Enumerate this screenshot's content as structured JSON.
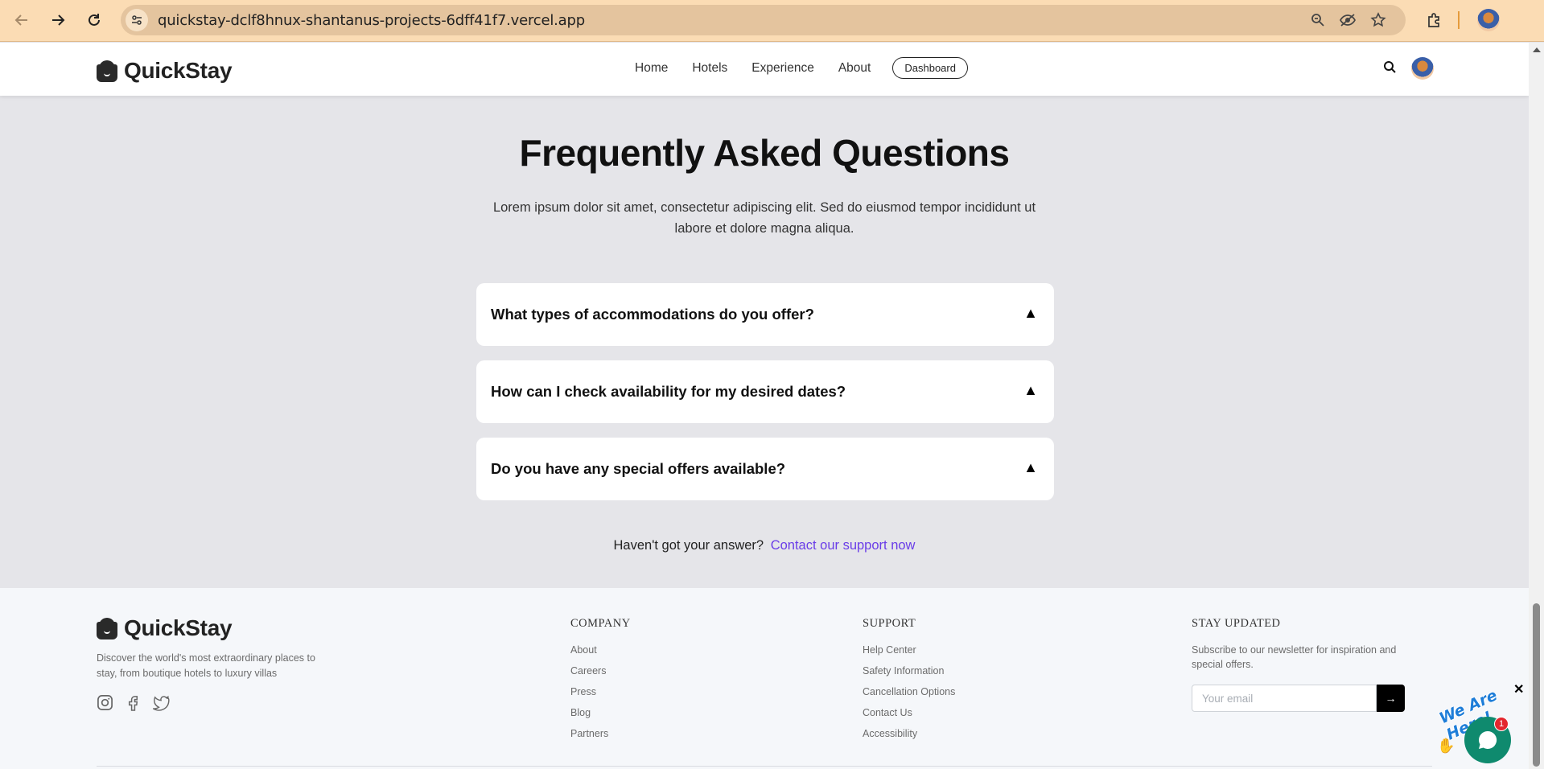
{
  "browser": {
    "url": "quickstay-dclf8hnux-shantanus-projects-6dff41f7.vercel.app"
  },
  "header": {
    "brand": "QuickStay",
    "nav": [
      "Home",
      "Hotels",
      "Experience",
      "About"
    ],
    "dashboard_label": "Dashboard"
  },
  "faq": {
    "title": "Frequently Asked Questions",
    "subtitle": "Lorem ipsum dolor sit amet, consectetur adipiscing elit. Sed do eiusmod tempor incididunt ut labore et dolore magna aliqua.",
    "items": [
      {
        "question": "What types of accommodations do you offer?",
        "toggle": "▲"
      },
      {
        "question": "How can I check availability for my desired dates?",
        "toggle": "▲"
      },
      {
        "question": "Do you have any special offers available?",
        "toggle": "▲"
      }
    ],
    "footer_text": "Haven't got your answer?",
    "footer_link": "Contact our support now"
  },
  "footer": {
    "brand": "QuickStay",
    "description": "Discover the world's most extraordinary places to stay, from boutique hotels to luxury villas",
    "socials": [
      "instagram-icon",
      "facebook-icon",
      "twitter-icon"
    ],
    "company": {
      "title": "COMPANY",
      "links": [
        "About",
        "Careers",
        "Press",
        "Blog",
        "Partners"
      ]
    },
    "support": {
      "title": "SUPPORT",
      "links": [
        "Help Center",
        "Safety Information",
        "Cancellation Options",
        "Contact Us",
        "Accessibility"
      ]
    },
    "newsletter": {
      "title": "STAY UPDATED",
      "text": "Subscribe to our newsletter for inspiration and special offers.",
      "placeholder": "Your email",
      "submit": "→"
    }
  },
  "chat": {
    "sticker": "We Are Here!",
    "badge": "1",
    "close": "✕"
  }
}
